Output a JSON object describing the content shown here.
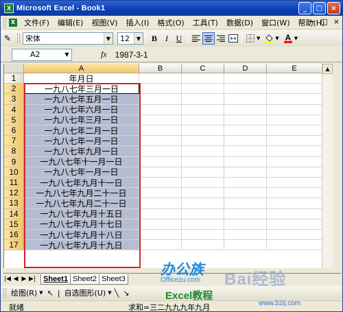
{
  "window": {
    "app_icon": "excel-icon",
    "title": "Microsoft Excel - Book1",
    "buttons": {
      "minimize": "_",
      "maximize": "□",
      "close": "×"
    }
  },
  "menubar": {
    "items": [
      "文件(F)",
      "编辑(E)",
      "视图(V)",
      "插入(I)",
      "格式(O)",
      "工具(T)",
      "数据(D)",
      "窗口(W)",
      "帮助(H)"
    ],
    "right_controls": [
      "−",
      "□",
      "×"
    ]
  },
  "toolbar": {
    "font_name": "宋体",
    "font_size": "12",
    "bold": "B",
    "italic": "I",
    "underline": "U",
    "align_left_icon": "align-left-icon",
    "align_center_icon": "align-center-icon",
    "align_right_icon": "align-right-icon",
    "merge_icon": "merge-center-icon",
    "fill_color": "#ffff00",
    "font_color": "#ff0000",
    "font_color_letter": "A"
  },
  "formula_bar": {
    "name_box": "A2",
    "fx_label": "fx",
    "value": "1987-3-1"
  },
  "grid": {
    "columns": [
      "A",
      "B",
      "C",
      "D",
      "E"
    ],
    "selected_column": "A",
    "rows": [
      "1",
      "2",
      "3",
      "4",
      "5",
      "6",
      "7",
      "8",
      "9",
      "10",
      "11",
      "12",
      "13",
      "14",
      "15",
      "16",
      "17"
    ],
    "column_a_values": [
      "年月日",
      "一九八七年三月一日",
      "一九八七年五月一日",
      "一九八七年六月一日",
      "一九八七年三月一日",
      "一九八七年二月一日",
      "一九八七年一月一日",
      "一九八七年九月一日",
      "一九八七年十一月一日",
      "一九八七年一月一日",
      "一九八七年九月十一日",
      "一九八七年九月二十一日",
      "一九八七年九月二十一日",
      "一九八七年九月十五日",
      "一九八七年九月十七日",
      "一九八七年九月十八日",
      "一九八七年九月十九日"
    ],
    "selection_color": "#b6bdd2",
    "highlight_border_color": "#d2232a"
  },
  "sheet_tabs": {
    "nav": [
      "|◀",
      "◀",
      "▶",
      "▶|"
    ],
    "tabs": [
      "Sheet1",
      "Sheet2",
      "Sheet3"
    ],
    "active": "Sheet1"
  },
  "drawing_toolbar": {
    "draw_label": "绘图(R)",
    "autoshapes_label": "自选图形(U)"
  },
  "status_bar": {
    "ready": "就绪",
    "sum": "求和=三二九九九年九月"
  },
  "watermarks": {
    "brand1": "办公族",
    "brand1_url": "Officezu.com",
    "brand2": "Excel教程",
    "brand3": "Bai经验",
    "brand3_url": "www.52ij.com"
  }
}
